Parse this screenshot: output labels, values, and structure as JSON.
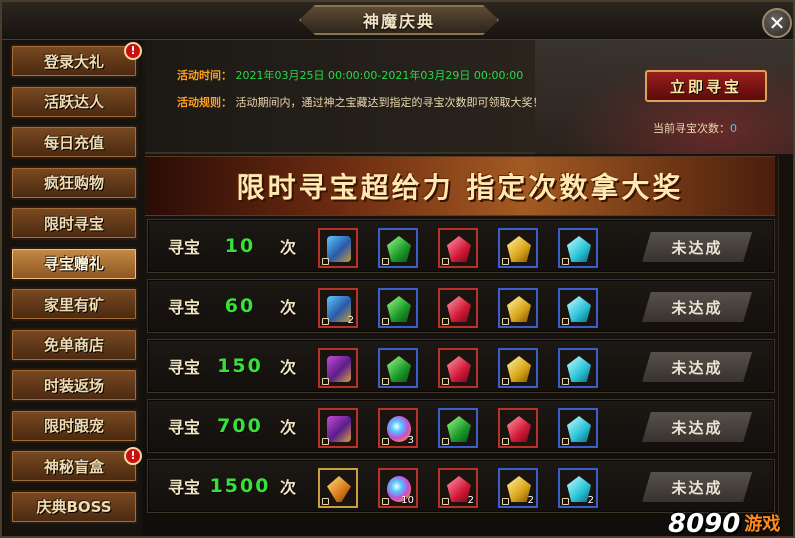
{
  "window": {
    "title": "神魔庆典",
    "close_label": "✕"
  },
  "sidebar": {
    "items": [
      {
        "label": "登录大礼",
        "badge": "!"
      },
      {
        "label": "活跃达人",
        "badge": ""
      },
      {
        "label": "每日充值",
        "badge": ""
      },
      {
        "label": "疯狂购物",
        "badge": ""
      },
      {
        "label": "限时寻宝",
        "badge": ""
      },
      {
        "label": "寻宝赠礼",
        "badge": "",
        "active": true
      },
      {
        "label": "家里有矿",
        "badge": ""
      },
      {
        "label": "免单商店",
        "badge": ""
      },
      {
        "label": "时装返场",
        "badge": ""
      },
      {
        "label": "限时跟宠",
        "badge": ""
      },
      {
        "label": "神秘盲盒",
        "badge": "!"
      },
      {
        "label": "庆典BOSS",
        "badge": ""
      }
    ]
  },
  "info": {
    "time_label": "活动时间：",
    "time_value": "2021年03月25日 00:00:00-2021年03月29日 00:00:00",
    "rule_label": "活动规则：",
    "rule_value": "活动期间内，通过神之宝藏达到指定的寻宝次数即可领取大奖！",
    "seek_button": "立即寻宝",
    "count_label": "当前寻宝次数：",
    "count_value": "0"
  },
  "banner": {
    "text": "限时寻宝超给力 指定次数拿大奖"
  },
  "rows": [
    {
      "word": "寻宝",
      "count": "10",
      "unit": "次",
      "status": "未达成",
      "items": [
        {
          "icon": "blue-chest",
          "qty": ""
        },
        {
          "icon": "green-gem",
          "qty": ""
        },
        {
          "icon": "red-gem",
          "qty": ""
        },
        {
          "icon": "yellow-gem",
          "qty": ""
        },
        {
          "icon": "cyan-gem",
          "qty": ""
        }
      ]
    },
    {
      "word": "寻宝",
      "count": "60",
      "unit": "次",
      "status": "未达成",
      "items": [
        {
          "icon": "blue-chest",
          "qty": "2"
        },
        {
          "icon": "green-gem",
          "qty": ""
        },
        {
          "icon": "red-gem",
          "qty": ""
        },
        {
          "icon": "yellow-gem",
          "qty": ""
        },
        {
          "icon": "cyan-gem",
          "qty": ""
        }
      ]
    },
    {
      "word": "寻宝",
      "count": "150",
      "unit": "次",
      "status": "未达成",
      "items": [
        {
          "icon": "purple-chest",
          "qty": ""
        },
        {
          "icon": "green-gem",
          "qty": ""
        },
        {
          "icon": "red-gem",
          "qty": ""
        },
        {
          "icon": "yellow-gem",
          "qty": ""
        },
        {
          "icon": "cyan-gem",
          "qty": ""
        }
      ]
    },
    {
      "word": "寻宝",
      "count": "700",
      "unit": "次",
      "status": "未达成",
      "items": [
        {
          "icon": "purple-chest",
          "qty": ""
        },
        {
          "icon": "rainbow-orb",
          "qty": "3"
        },
        {
          "icon": "green-gem",
          "qty": ""
        },
        {
          "icon": "red-gem",
          "qty": ""
        },
        {
          "icon": "cyan-gem",
          "qty": ""
        }
      ]
    },
    {
      "word": "寻宝",
      "count": "1500",
      "unit": "次",
      "status": "未达成",
      "items": [
        {
          "icon": "amber-gem",
          "qty": ""
        },
        {
          "icon": "rainbow-orb",
          "qty": "10"
        },
        {
          "icon": "red-gem",
          "qty": "2"
        },
        {
          "icon": "yellow-gem",
          "qty": "2"
        },
        {
          "icon": "cyan-gem",
          "qty": "2"
        }
      ]
    }
  ],
  "watermark": {
    "number": "8090",
    "text": "游戏"
  },
  "colors": {
    "label_orange": "#ff9f1a",
    "time_green": "#29d84a",
    "count_green": "#38e03a",
    "count_blue": "#4ec8ff"
  }
}
